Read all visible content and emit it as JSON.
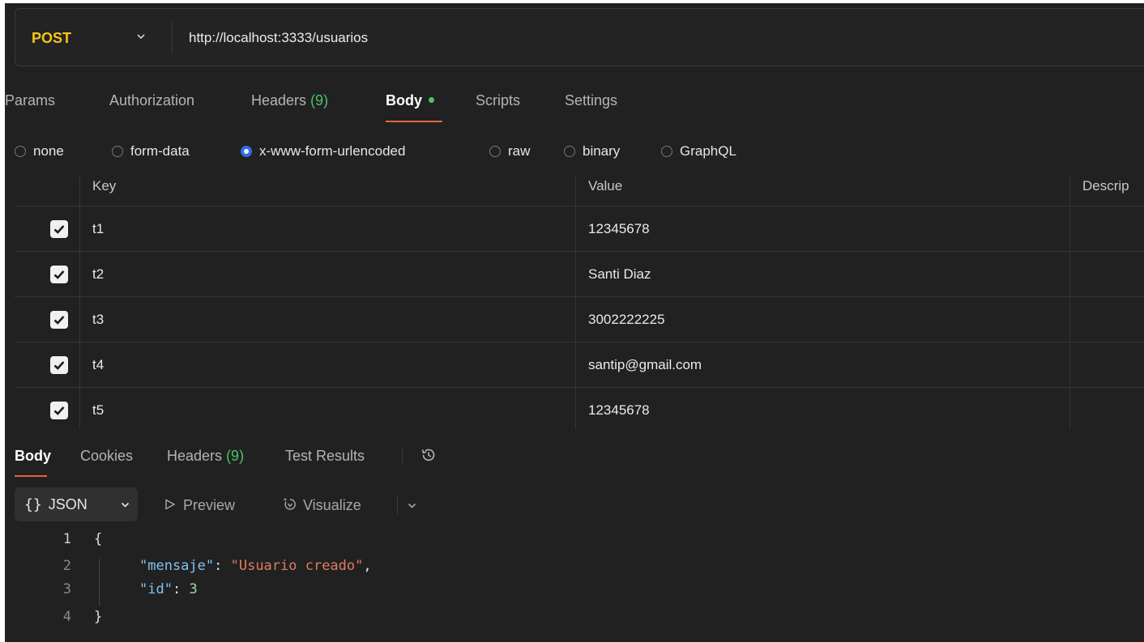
{
  "request": {
    "method": "POST",
    "url": "http://localhost:3333/usuarios"
  },
  "request_tabs": {
    "params": "Params",
    "authorization": "Authorization",
    "headers": "Headers",
    "headers_count": "(9)",
    "body": "Body",
    "scripts": "Scripts",
    "settings": "Settings"
  },
  "body_types": {
    "none": "none",
    "form_data": "form-data",
    "urlencoded": "x-www-form-urlencoded",
    "raw": "raw",
    "binary": "binary",
    "graphql": "GraphQL",
    "selected": "x-www-form-urlencoded"
  },
  "table": {
    "headers": {
      "key": "Key",
      "value": "Value",
      "description": "Descrip"
    },
    "rows": [
      {
        "key": "t1",
        "value": "12345678",
        "checked": true
      },
      {
        "key": "t2",
        "value": "Santi Diaz",
        "checked": true
      },
      {
        "key": "t3",
        "value": "3002222225",
        "checked": true
      },
      {
        "key": "t4",
        "value": "santip@gmail.com",
        "checked": true
      },
      {
        "key": "t5",
        "value": "12345678",
        "checked": true
      }
    ]
  },
  "response_tabs": {
    "body": "Body",
    "cookies": "Cookies",
    "headers": "Headers",
    "headers_count": "(9)",
    "test_results": "Test Results"
  },
  "format_toolbar": {
    "braces": "{}",
    "format": "JSON",
    "preview": "Preview",
    "visualize": "Visualize"
  },
  "response_code": {
    "line_numbers": [
      "1",
      "2",
      "3",
      "4"
    ],
    "open_brace": "{",
    "key1": "\"mensaje\"",
    "colon1": ": ",
    "value1": "\"Usuario creado\"",
    "comma": ",",
    "key2": "\"id\"",
    "colon2": ": ",
    "value2": "3",
    "close_brace": "}"
  },
  "colors": {
    "method": "#f5c518",
    "accent_underline": "#e8633a",
    "count_green": "#4cc36a",
    "radio_selected": "#2f6fe0",
    "json_key": "#7ec3f0",
    "json_string": "#e07b5f",
    "json_number": "#a5d6a7"
  },
  "icons": {
    "method_dropdown": "chevron-down-icon",
    "checkbox": "check-icon",
    "history": "history-icon",
    "preview": "play-outline-icon",
    "visualize": "sparkle-icon",
    "format_dropdown": "chevron-down-icon"
  }
}
